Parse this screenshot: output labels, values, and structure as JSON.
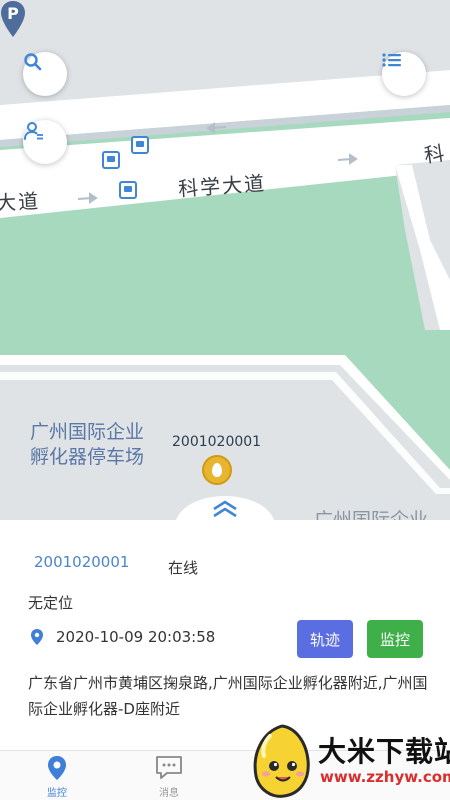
{
  "map": {
    "roads": {
      "main_label": "科学大道",
      "left_label": "大道",
      "right_label": "科"
    },
    "pois": {
      "parking_label_line1": "广州国际企业",
      "parking_label_line2": "孵化器停车场",
      "bottom_label": "广州国际企业"
    },
    "device_label": "2001020001",
    "buttons": {
      "search_icon": "search-icon",
      "list_icon": "list-icon",
      "user_icon": "user-switch-icon"
    },
    "colors": {
      "green_area": "#a7d9bf",
      "road": "#ffffff",
      "block": "#dfe3e6"
    }
  },
  "panel": {
    "device_id": "2001020001",
    "status": "在线",
    "location_status": "无定位",
    "timestamp": "2020-10-09 20:03:58",
    "track_button": "轨迹",
    "monitor_button": "监控",
    "address": "广东省广州市黄埔区掬泉路,广州国际企业孵化器附近,广州国际企业孵化器-D座附近",
    "colors": {
      "track_button": "#5b6ee1",
      "monitor_button": "#3fb049",
      "device_id": "#4a86c8"
    }
  },
  "tabbar": {
    "tabs": [
      {
        "label": "监控",
        "icon": "location-pin-icon",
        "active": true
      },
      {
        "label": "消息",
        "icon": "message-icon",
        "active": false
      }
    ]
  },
  "watermark": {
    "title": "大米下载站",
    "url": "www.zzhyw.com"
  }
}
